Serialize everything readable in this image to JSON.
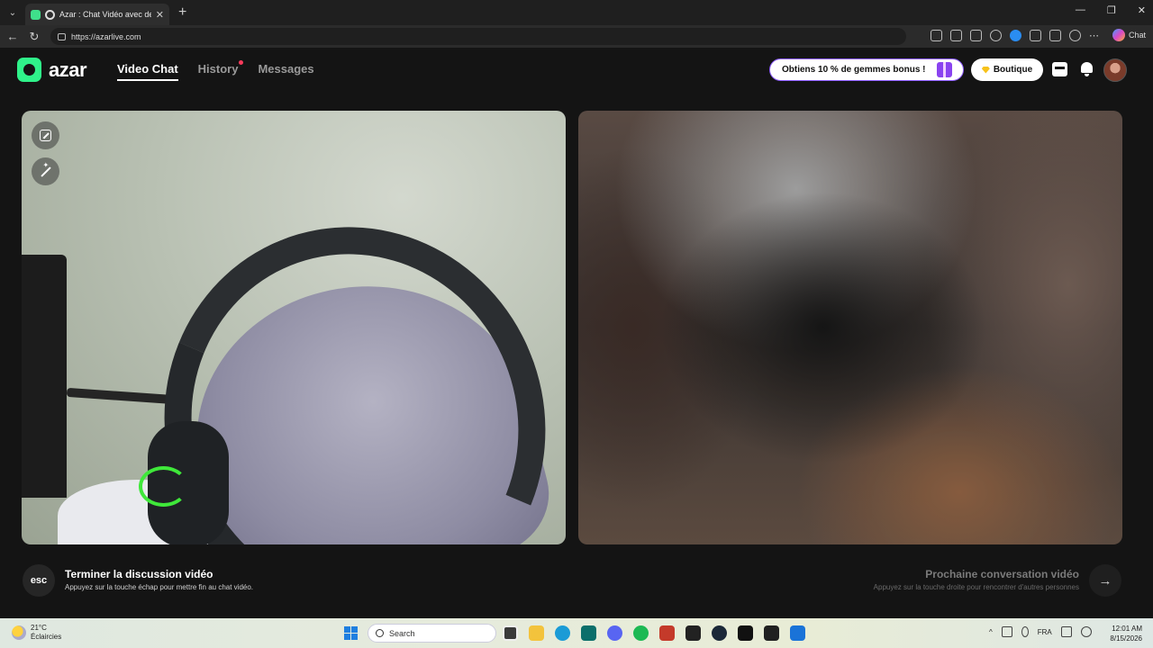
{
  "browser": {
    "tab_title": "Azar : Chat Vidéo avec de nouv",
    "tab_close": "✕",
    "new_tab": "+",
    "url": "https://azarlive.com",
    "chat_label": "Chat",
    "win_minimize": "—",
    "win_restore": "❐",
    "win_close": "✕",
    "back": "←",
    "reload": "↻",
    "more": "⋯"
  },
  "header": {
    "logo_text": "azar",
    "nav": {
      "video_chat": "Video Chat",
      "history": "History",
      "messages": "Messages"
    },
    "promo_label": "Obtiens 10 % de gemmes bonus !",
    "shop_label": "Boutique"
  },
  "controls": {
    "esc_label": "esc",
    "end_title": "Terminer la discussion vidéo",
    "end_subtitle": "Appuyez sur la touche échap pour mettre fin au chat vidéo.",
    "next_title": "Prochaine conversation vidéo",
    "next_subtitle": "Appuyez sur la touche droite pour rencontrer d'autres personnes",
    "next_arrow": "→"
  },
  "taskbar": {
    "temperature": "21°C",
    "weather": "Éclaircies",
    "search_placeholder": "Search",
    "language": "FRA",
    "time": "12:01 AM",
    "date": "8/15/2026"
  },
  "colors": {
    "accent": "#2ff28a",
    "promo_border": "#8d5cff",
    "notification_dot": "#ff3b5c",
    "background": "#141414"
  },
  "icons": {
    "tab_favicon": "azar-favicon-icon",
    "recording": "recording-icon",
    "expand": "expand-icon",
    "effects": "magic-wand-icon",
    "gift": "gift-icon",
    "gem": "gem-icon",
    "inbox": "inbox-icon",
    "bell": "bell-icon",
    "next": "arrow-right-icon"
  }
}
